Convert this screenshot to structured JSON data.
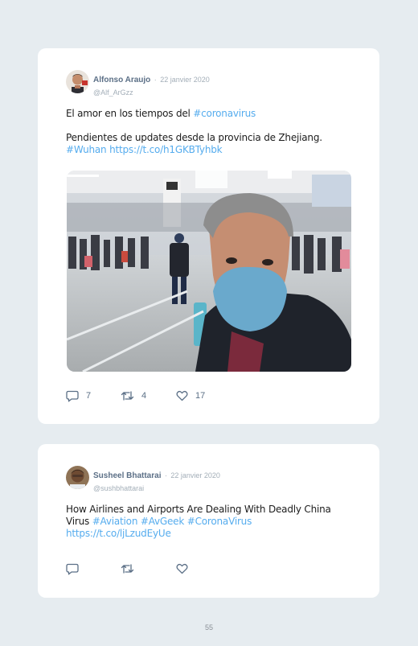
{
  "tweets": [
    {
      "author_name": "Alfonso Araujo",
      "separator": "·",
      "date": "22 janvier 2020",
      "handle": "@Alf_ArGzz",
      "line1_text": "El amor en los tiempos del ",
      "line1_hashtag": "#coronavirus",
      "line2_text": "Pendientes de updates desde la provincia de Zhejiang.",
      "line3_hashtag": "#Wuhan",
      "line3_link": "https://t.co/h1GKBTyhbk",
      "reply_count": "7",
      "retweet_count": "4",
      "like_count": "17",
      "icons": {
        "reply": "reply-icon",
        "retweet": "retweet-icon",
        "like": "heart-icon"
      }
    },
    {
      "author_name": "Susheel Bhattarai",
      "separator": "·",
      "date": "22 janvier 2020",
      "handle": "@sushbhattarai",
      "line1_text": "How Airlines and Airports Are Dealing With Deadly China",
      "line2_text": "Virus ",
      "line2_hashtags": "#Aviation #AvGeek #CoronaVirus",
      "line3_link": "https://t.co/ljLzudEyUe",
      "reply_count": "",
      "retweet_count": "",
      "like_count": "",
      "icons": {
        "reply": "reply-icon",
        "retweet": "retweet-icon",
        "like": "heart-icon"
      }
    }
  ],
  "page_number": "55",
  "colors": {
    "link": "#55acee",
    "name": "#5b6f86",
    "muted": "#a3aeb8",
    "background": "#e6ecf0"
  }
}
